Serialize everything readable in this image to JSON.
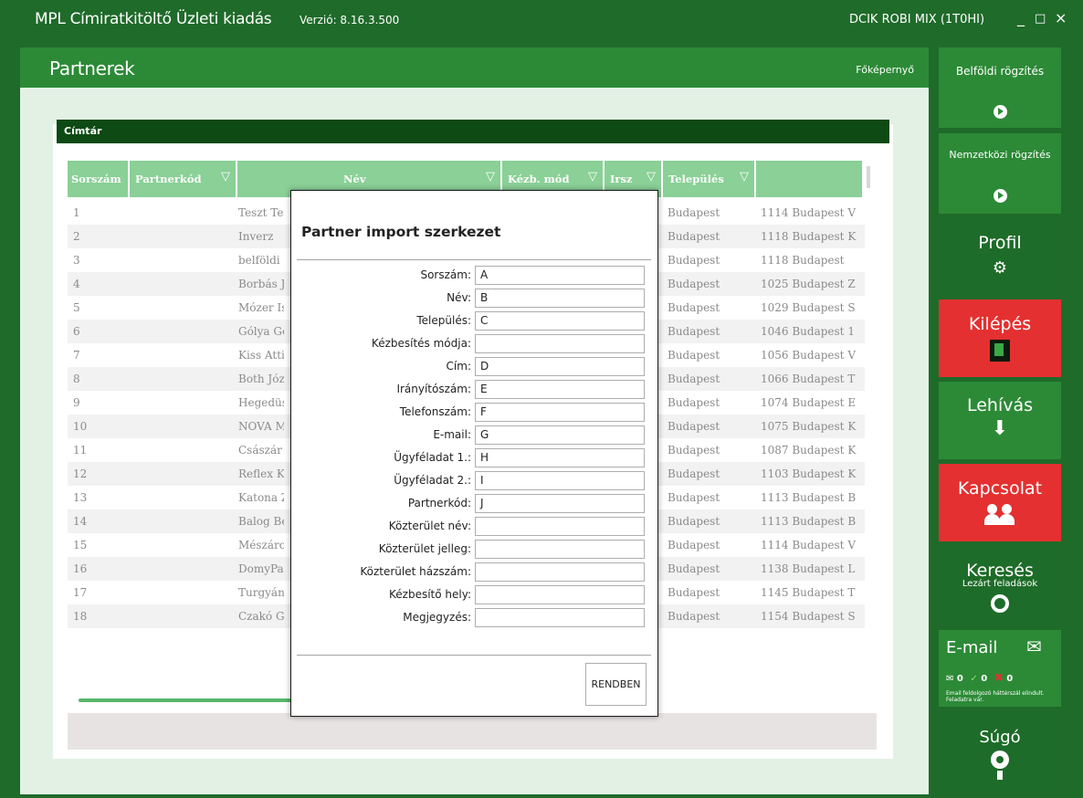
{
  "window": {
    "title": "MPL Címiratkitöltő Üzleti kiadás",
    "version": "Verzió: 8.16.3.500",
    "user": "DCIK ROBI MIX (1T0HI)",
    "controls": [
      "_",
      "□",
      "×"
    ]
  },
  "page": {
    "title": "Partnerek",
    "home_link": "Főképernyő"
  },
  "directory": {
    "title": "Címtár",
    "columns": [
      {
        "label": "Sorszám",
        "filter": false
      },
      {
        "label": "Partnerkód",
        "filter": true
      },
      {
        "label": "Név",
        "filter": true
      },
      {
        "label": "Kézb. mód",
        "filter": true
      },
      {
        "label": "Irsz",
        "filter": true
      },
      {
        "label": "Település",
        "filter": true
      },
      {
        "label": "",
        "filter": false
      }
    ],
    "rows": [
      {
        "num": "1",
        "name": "Teszt Te",
        "city": "Budapest",
        "address": "1114 Budapest V"
      },
      {
        "num": "2",
        "name": "Inverz",
        "city": "Budapest",
        "address": "1118 Budapest K"
      },
      {
        "num": "3",
        "name": "belföldi",
        "city": "Budapest",
        "address": "1118 Budapest"
      },
      {
        "num": "4",
        "name": "Borbás J",
        "city": "Budapest",
        "address": "1025 Budapest Z"
      },
      {
        "num": "5",
        "name": "Mózer Is",
        "city": "Budapest",
        "address": "1029 Budapest S"
      },
      {
        "num": "6",
        "name": "Gólya Gé",
        "city": "Budapest",
        "address": "1046 Budapest 1"
      },
      {
        "num": "7",
        "name": "Kiss Attil",
        "city": "Budapest",
        "address": "1056 Budapest V"
      },
      {
        "num": "8",
        "name": "Both Józ",
        "city": "Budapest",
        "address": "1066 Budapest T"
      },
      {
        "num": "9",
        "name": "Hegedüs",
        "city": "Budapest",
        "address": "1074 Budapest E"
      },
      {
        "num": "10",
        "name": "NOVA M",
        "city": "Budapest",
        "address": "1075 Budapest K"
      },
      {
        "num": "11",
        "name": "Császár",
        "city": "Budapest",
        "address": "1087 Budapest K"
      },
      {
        "num": "12",
        "name": "Reflex Kf",
        "city": "Budapest",
        "address": "1103 Budapest K"
      },
      {
        "num": "13",
        "name": "Katona Z",
        "city": "Budapest",
        "address": "1113 Budapest B"
      },
      {
        "num": "14",
        "name": "Balog Bé",
        "city": "Budapest",
        "address": "1113 Budapest B"
      },
      {
        "num": "15",
        "name": "Mészáro",
        "city": "Budapest",
        "address": "1114 Budapest V"
      },
      {
        "num": "16",
        "name": "DomyPa",
        "city": "Budapest",
        "address": "1138 Budapest L"
      },
      {
        "num": "17",
        "name": "Turgyán",
        "city": "Budapest",
        "address": "1145 Budapest T"
      },
      {
        "num": "18",
        "name": "Czakó G",
        "city": "Budapest",
        "address": "1154 Budapest S"
      }
    ]
  },
  "dialog": {
    "title": "Partner import szerkezet",
    "fields": [
      {
        "label": "Sorszám:",
        "value": "A"
      },
      {
        "label": "Név:",
        "value": "B"
      },
      {
        "label": "Település:",
        "value": "C"
      },
      {
        "label": "Kézbesítés módja:",
        "value": ""
      },
      {
        "label": "Cím:",
        "value": "D"
      },
      {
        "label": "Irányítószám:",
        "value": "E"
      },
      {
        "label": "Telefonszám:",
        "value": "F"
      },
      {
        "label": "E-mail:",
        "value": "G"
      },
      {
        "label": "Ügyféladat 1.:",
        "value": "H"
      },
      {
        "label": "Ügyféladat 2.:",
        "value": "I"
      },
      {
        "label": "Partnerkód:",
        "value": "J"
      },
      {
        "label": "Közterület név:",
        "value": ""
      },
      {
        "label": "Közterület jelleg:",
        "value": ""
      },
      {
        "label": "Közterület házszám:",
        "value": ""
      },
      {
        "label": "Kézbesítő hely:",
        "value": ""
      },
      {
        "label": "Megjegyzés:",
        "value": ""
      }
    ],
    "ok_label": "RENDBEN"
  },
  "sidebar": {
    "domestic": "Belföldi rögzítés",
    "international": "Nemzetközi rögzítés",
    "profile": "Profil",
    "exit": "Kilépés",
    "download": "Lehívás",
    "contact": "Kapcsolat",
    "search": "Keresés",
    "search_sub": "Lezárt feladások",
    "email": "E-mail",
    "email_counts": [
      "0",
      "0",
      "0"
    ],
    "email_note": "Email feldolgozó háttérszál elindult. Feladatra vár.",
    "help": "Súgó"
  },
  "colors": {
    "frame": "#1f6b2a",
    "header_green": "#2c8a36",
    "grid_header": "#8ad097",
    "card_header": "#0d4a14",
    "danger": "#e43030"
  }
}
